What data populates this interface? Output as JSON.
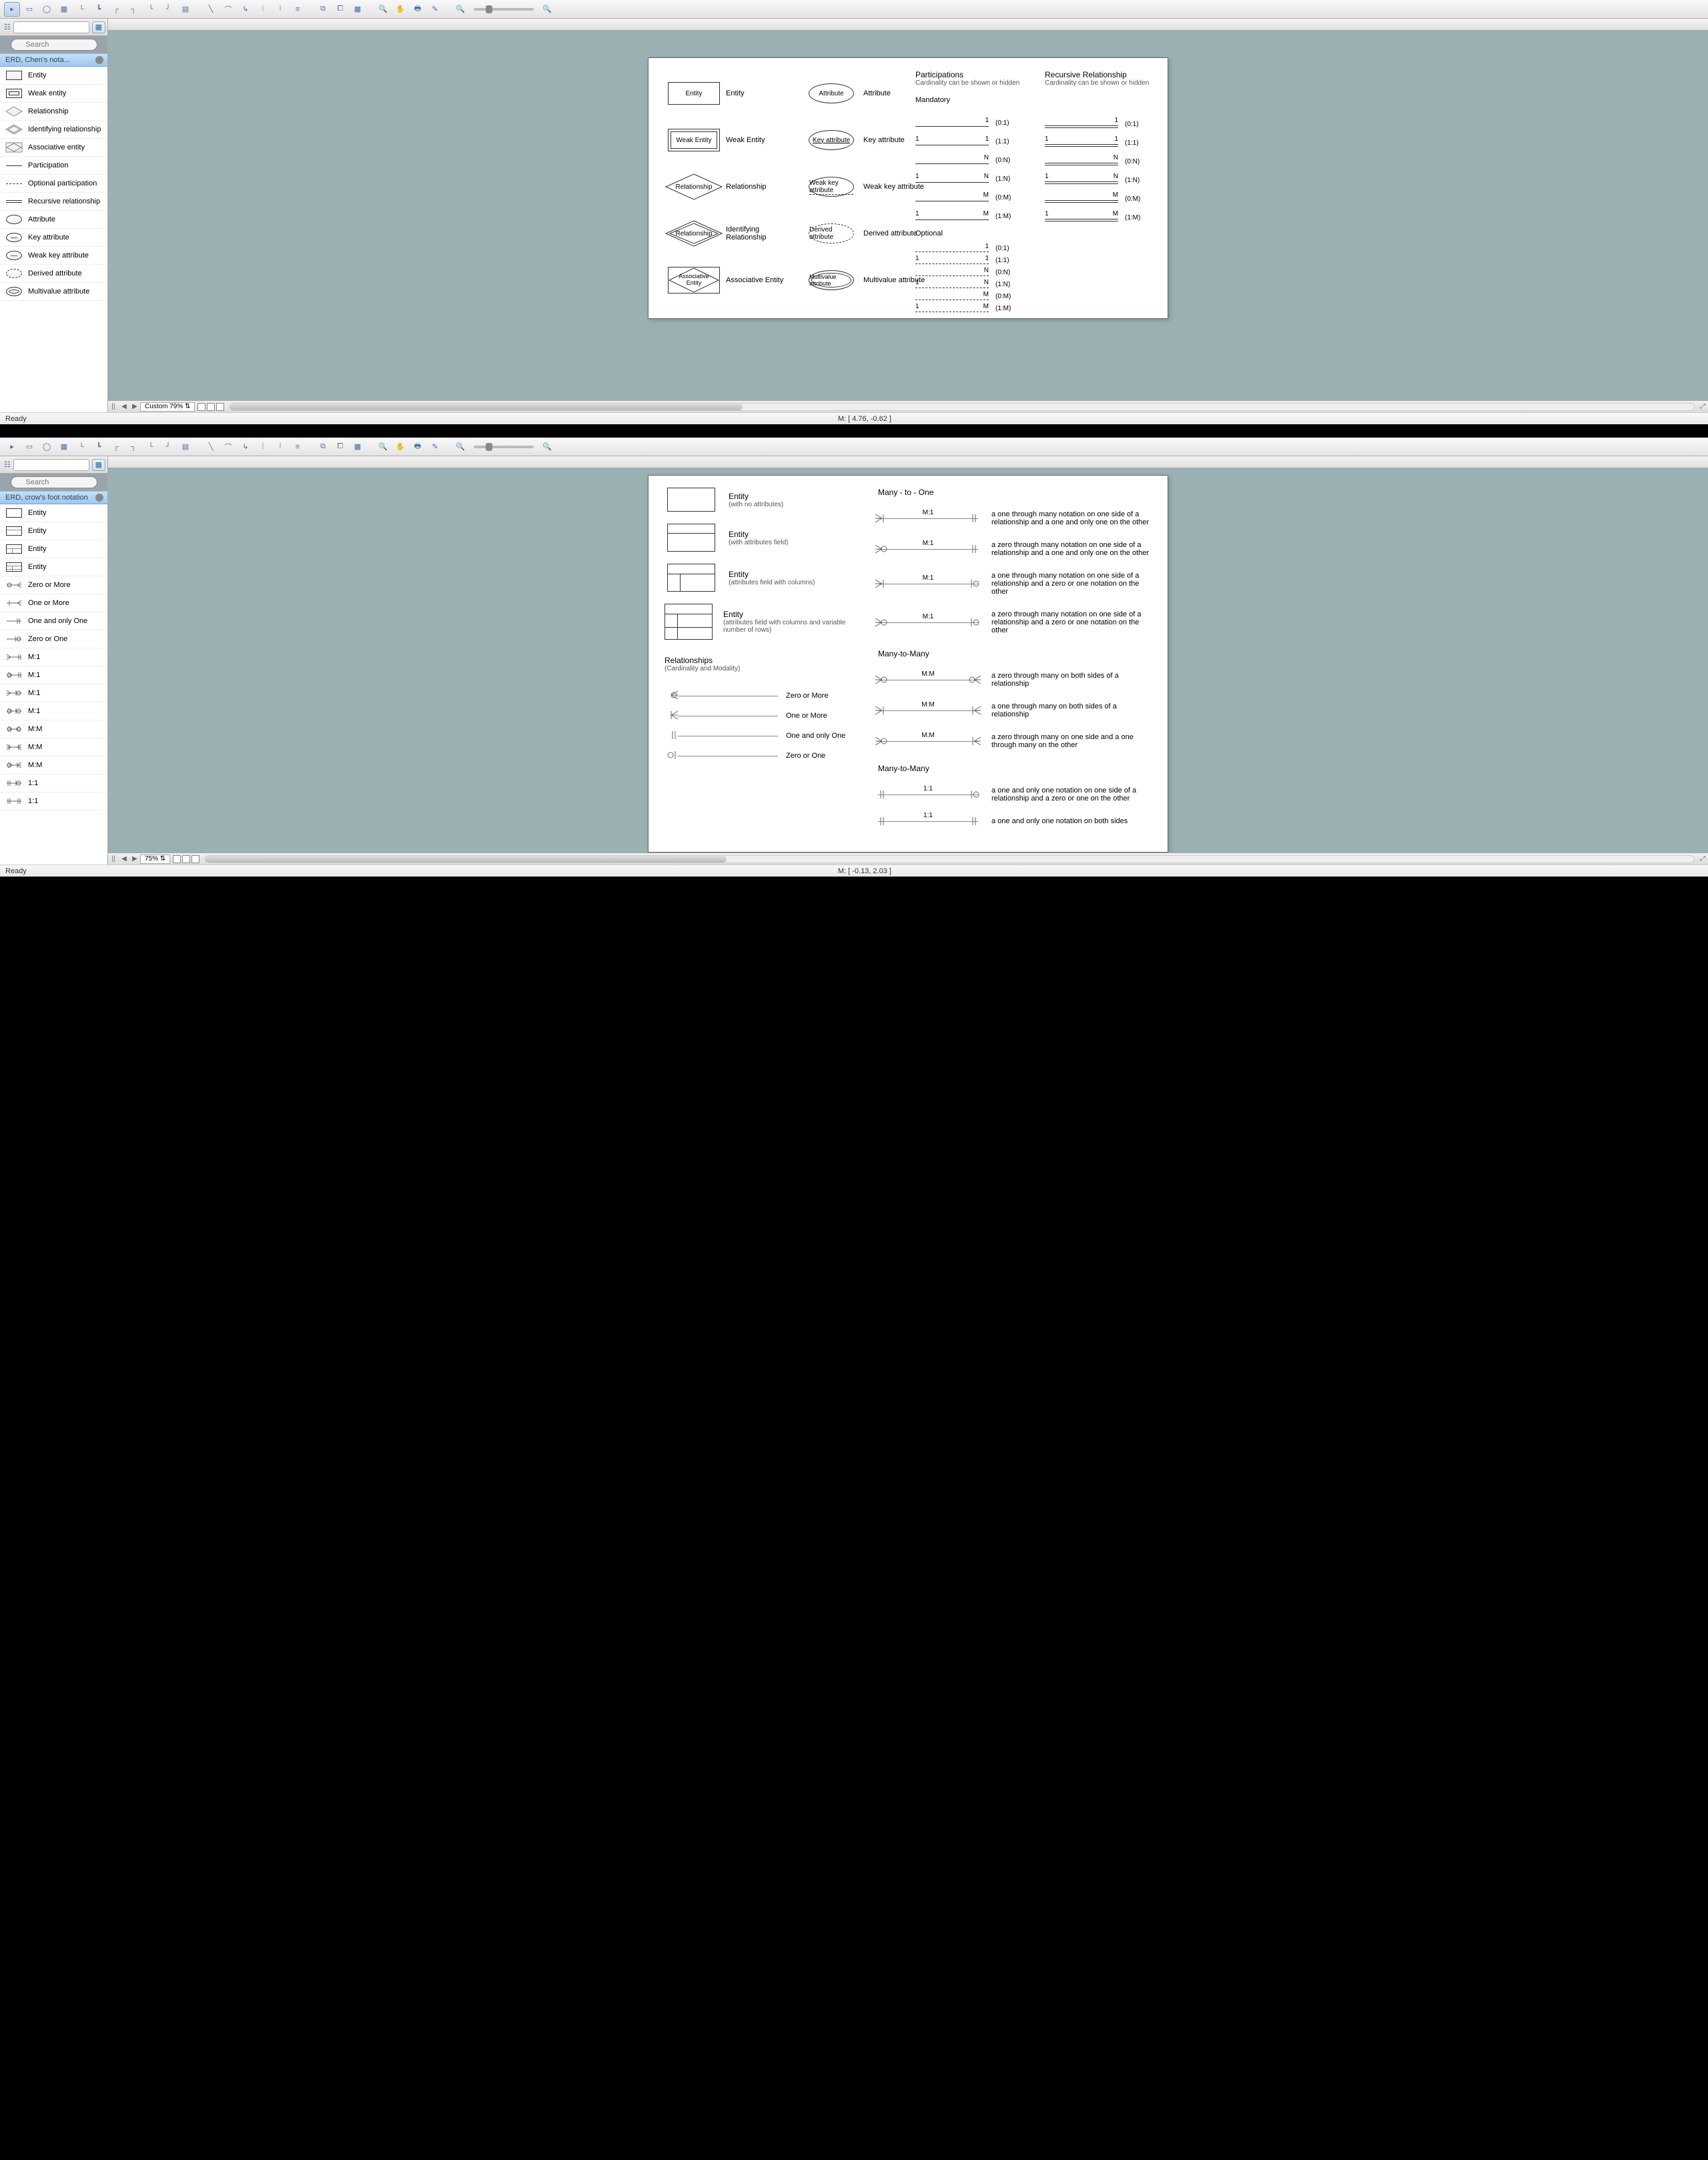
{
  "app1": {
    "search_placeholder": "Search",
    "section_title": "ERD, Chen's nota...",
    "side_items": [
      "Entity",
      "Weak entity",
      "Relationship",
      "Identifying relationship",
      "Associative entity",
      "Participation",
      "Optional participation",
      "Recursive relationship",
      "Attribute",
      "Key attribute",
      "Weak key attribute",
      "Derived attribute",
      "Multivalue attribute"
    ],
    "zoom_label": "Custom 79%",
    "status_ready": "Ready",
    "coords": "M: [ 4.76, -0.62 ]",
    "diagram": {
      "col1": [
        {
          "shape_label": "Entity",
          "caption": "Entity"
        },
        {
          "shape_label": "Weak Entity",
          "caption": "Weak Entity"
        },
        {
          "shape_label": "Relationship",
          "caption": "Relationship"
        },
        {
          "shape_label": "Relationship",
          "caption": "Identifying Relationship"
        },
        {
          "shape_label": "Associative Entity",
          "caption": "Associative Entity"
        }
      ],
      "col2": [
        {
          "shape_label": "Attribute",
          "caption": "Attribute"
        },
        {
          "shape_label": "Key attribute",
          "caption": "Key attribute"
        },
        {
          "shape_label": "Weak key attribute",
          "caption": "Weak key attribute"
        },
        {
          "shape_label": "Derived attribute",
          "caption": "Derived attribute"
        },
        {
          "shape_label": "Multivalue attribute",
          "caption": "Multivalue attribute"
        }
      ],
      "participations_title": "Participations",
      "participations_sub": "Cardinality can be shown or hidden",
      "mandatory_title": "Mandatory",
      "optional_title": "Optional",
      "recursive_title": "Recursive Relationship",
      "recursive_sub": "Cardinality can be shown or hidden",
      "mandatory": [
        {
          "left": "",
          "right": "1",
          "label": "(0:1)"
        },
        {
          "left": "1",
          "right": "1",
          "label": "(1:1)"
        },
        {
          "left": "",
          "right": "N",
          "label": "(0:N)"
        },
        {
          "left": "1",
          "right": "N",
          "label": "(1:N)"
        },
        {
          "left": "",
          "right": "M",
          "label": "(0:M)"
        },
        {
          "left": "1",
          "right": "M",
          "label": "(1:M)"
        }
      ],
      "optional": [
        {
          "left": "",
          "right": "1",
          "label": "(0:1)"
        },
        {
          "left": "1",
          "right": "1",
          "label": "(1:1)"
        },
        {
          "left": "",
          "right": "N",
          "label": "(0:N)"
        },
        {
          "left": "1",
          "right": "N",
          "label": "(1:N)"
        },
        {
          "left": "",
          "right": "M",
          "label": "(0:M)"
        },
        {
          "left": "1",
          "right": "M",
          "label": "(1:M)"
        }
      ],
      "recursive": [
        {
          "left": "",
          "right": "1",
          "label": "(0:1)"
        },
        {
          "left": "1",
          "right": "1",
          "label": "(1:1)"
        },
        {
          "left": "",
          "right": "N",
          "label": "(0:N)"
        },
        {
          "left": "1",
          "right": "N",
          "label": "(1:N)"
        },
        {
          "left": "",
          "right": "M",
          "label": "(0:M)"
        },
        {
          "left": "1",
          "right": "M",
          "label": "(1:M)"
        }
      ]
    }
  },
  "app2": {
    "search_placeholder": "Search",
    "section_title": "ERD, crow's foot notation",
    "side_items": [
      "Entity",
      "Entity",
      "Entity",
      "Entity",
      "Zero or More",
      "One or More",
      "One and only One",
      "Zero or One",
      "M:1",
      "M:1",
      "M:1",
      "M:1",
      "M:M",
      "M:M",
      "M:M",
      "1:1",
      "1:1"
    ],
    "zoom_label": "75%",
    "status_ready": "Ready",
    "coords": "M: [ -0.13, 2.03 ]",
    "diagram": {
      "entities": [
        {
          "title": "Entity",
          "sub": "(with no attributes)"
        },
        {
          "title": "Entity",
          "sub": "(with attributes field)"
        },
        {
          "title": "Entity",
          "sub": "(attributes field with columns)"
        },
        {
          "title": "Entity",
          "sub": "(attributes field with columns and variable number of rows)"
        }
      ],
      "relationships_title": "Relationships",
      "relationships_sub": "(Cardinality and Modality)",
      "cardinalities": [
        {
          "label": "Zero or More"
        },
        {
          "label": "One or More"
        },
        {
          "label": "One and only One"
        },
        {
          "label": "Zero or One"
        }
      ],
      "m1_title": "Many - to - One",
      "m1": [
        {
          "line": "M:1",
          "desc": "a one through many notation on one side of a relationship and a one and only one on the other"
        },
        {
          "line": "M:1",
          "desc": "a zero through many notation on one side of a relationship and a one and only one on the other"
        },
        {
          "line": "M:1",
          "desc": "a one through many notation on one side of a relationship and a zero or one notation on the other"
        },
        {
          "line": "M:1",
          "desc": "a zero through many notation on one side of a relationship and a zero or one notation on the other"
        }
      ],
      "mm_title": "Many-to-Many",
      "mm": [
        {
          "line": "M:M",
          "desc": "a zero through many on both sides of a relationship"
        },
        {
          "line": "M:M",
          "desc": "a one through many on both sides of a relationship"
        },
        {
          "line": "M:M",
          "desc": "a zero through many on one side and a one through many on the other"
        }
      ],
      "oo_title": "Many-to-Many",
      "oo": [
        {
          "line": "1:1",
          "desc": "a one and only one notation on one side of a relationship and a zero or one on the other"
        },
        {
          "line": "1:1",
          "desc": "a one and only one notation on both sides"
        }
      ]
    }
  }
}
